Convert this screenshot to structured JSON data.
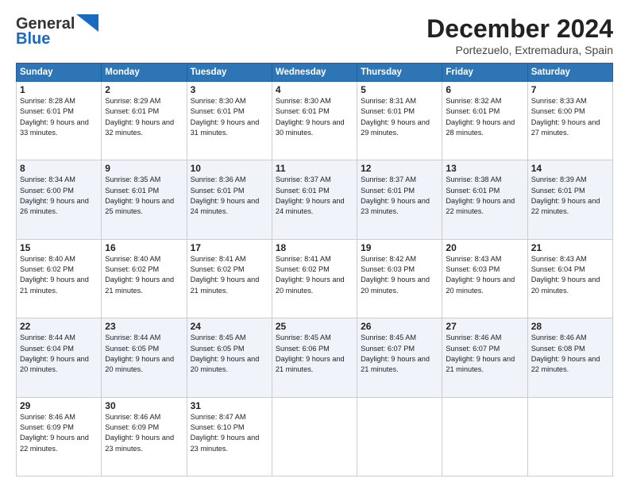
{
  "logo": {
    "line1": "General",
    "line2": "Blue"
  },
  "title": "December 2024",
  "location": "Portezuelo, Extremadura, Spain",
  "days_of_week": [
    "Sunday",
    "Monday",
    "Tuesday",
    "Wednesday",
    "Thursday",
    "Friday",
    "Saturday"
  ],
  "weeks": [
    [
      {
        "day": "1",
        "sunrise": "8:28 AM",
        "sunset": "6:01 PM",
        "daylight": "9 hours and 33 minutes."
      },
      {
        "day": "2",
        "sunrise": "8:29 AM",
        "sunset": "6:01 PM",
        "daylight": "9 hours and 32 minutes."
      },
      {
        "day": "3",
        "sunrise": "8:30 AM",
        "sunset": "6:01 PM",
        "daylight": "9 hours and 31 minutes."
      },
      {
        "day": "4",
        "sunrise": "8:30 AM",
        "sunset": "6:01 PM",
        "daylight": "9 hours and 30 minutes."
      },
      {
        "day": "5",
        "sunrise": "8:31 AM",
        "sunset": "6:01 PM",
        "daylight": "9 hours and 29 minutes."
      },
      {
        "day": "6",
        "sunrise": "8:32 AM",
        "sunset": "6:01 PM",
        "daylight": "9 hours and 28 minutes."
      },
      {
        "day": "7",
        "sunrise": "8:33 AM",
        "sunset": "6:00 PM",
        "daylight": "9 hours and 27 minutes."
      }
    ],
    [
      {
        "day": "8",
        "sunrise": "8:34 AM",
        "sunset": "6:00 PM",
        "daylight": "9 hours and 26 minutes."
      },
      {
        "day": "9",
        "sunrise": "8:35 AM",
        "sunset": "6:01 PM",
        "daylight": "9 hours and 25 minutes."
      },
      {
        "day": "10",
        "sunrise": "8:36 AM",
        "sunset": "6:01 PM",
        "daylight": "9 hours and 24 minutes."
      },
      {
        "day": "11",
        "sunrise": "8:37 AM",
        "sunset": "6:01 PM",
        "daylight": "9 hours and 24 minutes."
      },
      {
        "day": "12",
        "sunrise": "8:37 AM",
        "sunset": "6:01 PM",
        "daylight": "9 hours and 23 minutes."
      },
      {
        "day": "13",
        "sunrise": "8:38 AM",
        "sunset": "6:01 PM",
        "daylight": "9 hours and 22 minutes."
      },
      {
        "day": "14",
        "sunrise": "8:39 AM",
        "sunset": "6:01 PM",
        "daylight": "9 hours and 22 minutes."
      }
    ],
    [
      {
        "day": "15",
        "sunrise": "8:40 AM",
        "sunset": "6:02 PM",
        "daylight": "9 hours and 21 minutes."
      },
      {
        "day": "16",
        "sunrise": "8:40 AM",
        "sunset": "6:02 PM",
        "daylight": "9 hours and 21 minutes."
      },
      {
        "day": "17",
        "sunrise": "8:41 AM",
        "sunset": "6:02 PM",
        "daylight": "9 hours and 21 minutes."
      },
      {
        "day": "18",
        "sunrise": "8:41 AM",
        "sunset": "6:02 PM",
        "daylight": "9 hours and 20 minutes."
      },
      {
        "day": "19",
        "sunrise": "8:42 AM",
        "sunset": "6:03 PM",
        "daylight": "9 hours and 20 minutes."
      },
      {
        "day": "20",
        "sunrise": "8:43 AM",
        "sunset": "6:03 PM",
        "daylight": "9 hours and 20 minutes."
      },
      {
        "day": "21",
        "sunrise": "8:43 AM",
        "sunset": "6:04 PM",
        "daylight": "9 hours and 20 minutes."
      }
    ],
    [
      {
        "day": "22",
        "sunrise": "8:44 AM",
        "sunset": "6:04 PM",
        "daylight": "9 hours and 20 minutes."
      },
      {
        "day": "23",
        "sunrise": "8:44 AM",
        "sunset": "6:05 PM",
        "daylight": "9 hours and 20 minutes."
      },
      {
        "day": "24",
        "sunrise": "8:45 AM",
        "sunset": "6:05 PM",
        "daylight": "9 hours and 20 minutes."
      },
      {
        "day": "25",
        "sunrise": "8:45 AM",
        "sunset": "6:06 PM",
        "daylight": "9 hours and 21 minutes."
      },
      {
        "day": "26",
        "sunrise": "8:45 AM",
        "sunset": "6:07 PM",
        "daylight": "9 hours and 21 minutes."
      },
      {
        "day": "27",
        "sunrise": "8:46 AM",
        "sunset": "6:07 PM",
        "daylight": "9 hours and 21 minutes."
      },
      {
        "day": "28",
        "sunrise": "8:46 AM",
        "sunset": "6:08 PM",
        "daylight": "9 hours and 22 minutes."
      }
    ],
    [
      {
        "day": "29",
        "sunrise": "8:46 AM",
        "sunset": "6:09 PM",
        "daylight": "9 hours and 22 minutes."
      },
      {
        "day": "30",
        "sunrise": "8:46 AM",
        "sunset": "6:09 PM",
        "daylight": "9 hours and 23 minutes."
      },
      {
        "day": "31",
        "sunrise": "8:47 AM",
        "sunset": "6:10 PM",
        "daylight": "9 hours and 23 minutes."
      },
      null,
      null,
      null,
      null
    ]
  ]
}
